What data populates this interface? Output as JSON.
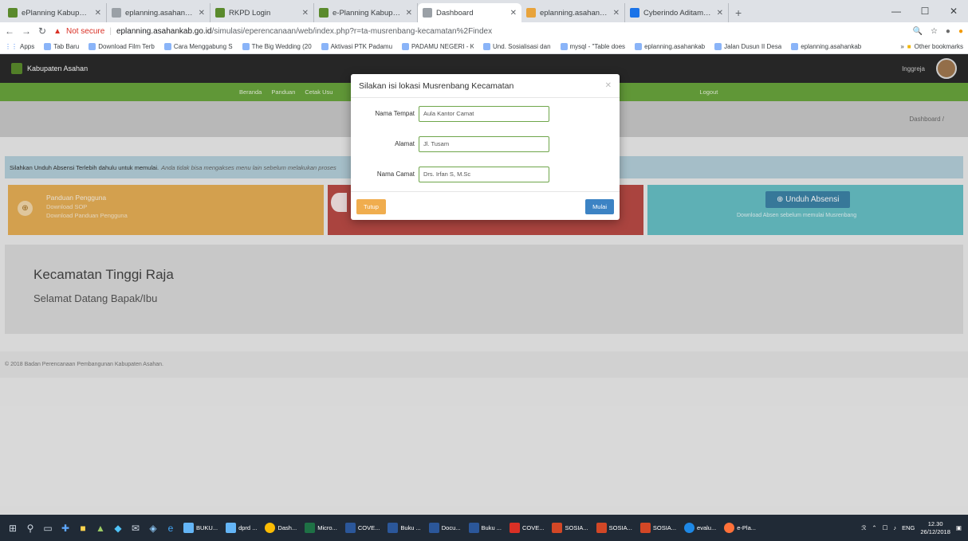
{
  "browser": {
    "tabs": [
      {
        "title": "ePlanning Kabupaten Asahan",
        "color": "#5a8a2c"
      },
      {
        "title": "eplanning.asahankab.go.id/2019",
        "color": "#9aa0a6"
      },
      {
        "title": "RKPD Login",
        "color": "#5a8a2c"
      },
      {
        "title": "e-Planning Kabupaten Asahan",
        "color": "#5a8a2c"
      },
      {
        "title": "Dashboard",
        "color": "#9aa0a6"
      },
      {
        "title": "eplanning.asahankab.go.id / loca",
        "color": "#e8a33b"
      },
      {
        "title": "Cyberindo Aditama | Speedtest",
        "color": "#1a73e8"
      }
    ],
    "address": {
      "security": "Not secure",
      "host": "eplanning.asahankab.go.id",
      "path": "/simulasi/eperencanaan/web/index.php?r=ta-musrenbang-kecamatan%2Findex"
    },
    "bookmarks": [
      "Apps",
      "Tab Baru",
      "Download Film Terb",
      "Cara Menggabung S",
      "The Big Wedding (20",
      "Aktivasi PTK Padamu",
      "PADAMU NEGERI - K",
      "Und. Sosialisasi dan",
      "mysql - \"Table does",
      "eplanning.asahankab",
      "Jalan Dusun II Desa",
      "eplanning.asahankab"
    ],
    "other_bookmarks": "Other bookmarks"
  },
  "site": {
    "brand": "Kabupaten Asahan",
    "language": "Inggreja",
    "nav": [
      "Beranda",
      "Panduan",
      "Cetak Usu"
    ],
    "logout": "Logout",
    "breadcrumb": "Dashboard  /",
    "alert": "Silahkan Unduh Absensi Terlebih dahulu untuk memulai.",
    "alert_note": "Anda tidak bisa mengakses menu lain sebelum melakukan proses",
    "cards": {
      "guide": {
        "title": "Panduan Pengguna",
        "line1": "Download SOP",
        "line2": "Download Panduan Pengguna"
      },
      "absen": {
        "button": "Unduh Absensi",
        "sub": "Download Absen sebelum memulai Musrenbang"
      }
    },
    "welcome_title": "Kecamatan Tinggi Raja",
    "welcome_sub": "Selamat Datang Bapak/Ibu",
    "footer": "© 2018 Badan Perencanaan Pembangunan Kabupaten Asahan."
  },
  "modal": {
    "title": "Silakan isi lokasi Musrenbang Kecamatan",
    "fields": [
      {
        "label": "Nama Tempat",
        "value": "Aula Kantor Camat"
      },
      {
        "label": "Alamat",
        "value": "Jl. Tusam"
      },
      {
        "label": "Nama Camat",
        "value": "Drs. Irfan S, M.Sc"
      }
    ],
    "close_button": "Tutup",
    "start_button": "Mulai"
  },
  "taskbar": {
    "apps": [
      "BUKU...",
      "dprd ...",
      "Dash...",
      "Micro...",
      "COVE...",
      "Buku ...",
      "Docu...",
      "Buku ...",
      "COVE...",
      "SOSIA...",
      "SOSIA...",
      "SOSIA...",
      "evalu...",
      "e-Pla..."
    ],
    "lang": "ENG",
    "time": "12.30",
    "date": "26/12/2018"
  }
}
